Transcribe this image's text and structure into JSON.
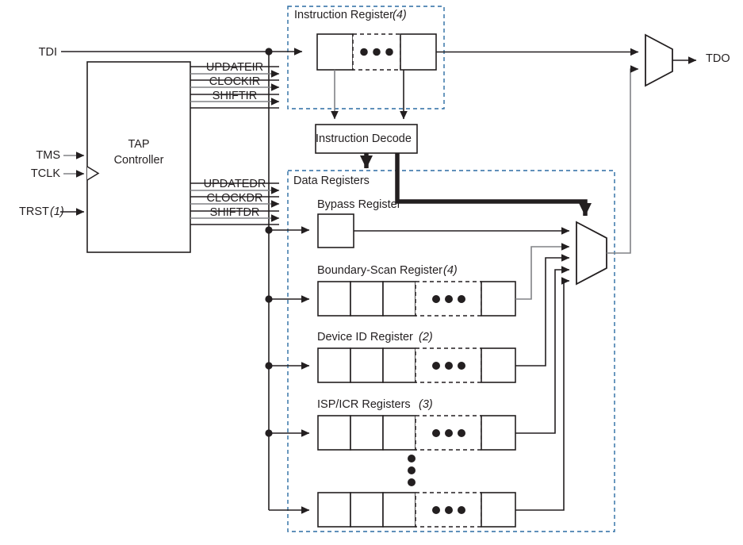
{
  "diagram": {
    "title": "JTAG TAP Controller Block Diagram",
    "colors": {
      "ink": "#231f20",
      "group_dash": "#2b6ca3",
      "gray_wire": "#808285",
      "background": "#ffffff"
    }
  },
  "inputs": {
    "tdi": "TDI",
    "tms": "TMS",
    "tclk": "TCLK",
    "trst": "TRST",
    "trst_note": "(1)"
  },
  "outputs": {
    "tdo": "TDO"
  },
  "tap": {
    "line1": "TAP",
    "line2": "Controller"
  },
  "ir_signals": [
    "UPDATEIR",
    "CLOCKIR",
    "SHIFTIR"
  ],
  "dr_signals": [
    "UPDATEDR",
    "CLOCKDR",
    "SHIFTDR"
  ],
  "groups": {
    "instruction_register": {
      "label": "Instruction Register",
      "note": "(4)"
    },
    "data_registers": {
      "label": "Data Registers"
    }
  },
  "blocks": {
    "instruction_decode": "Instruction Decode",
    "bypass_register": "Bypass Register"
  },
  "registers": [
    {
      "label": "Boundary-Scan Register",
      "note": "(4)"
    },
    {
      "label": "Device ID Register",
      "note": "(2)"
    },
    {
      "label": "ISP/ICR Registers",
      "note": "(3)"
    },
    {
      "label": "",
      "note": ""
    }
  ],
  "ellipsis": {
    "horizontal": "• • •",
    "vertical": "vertical-ellipsis"
  }
}
